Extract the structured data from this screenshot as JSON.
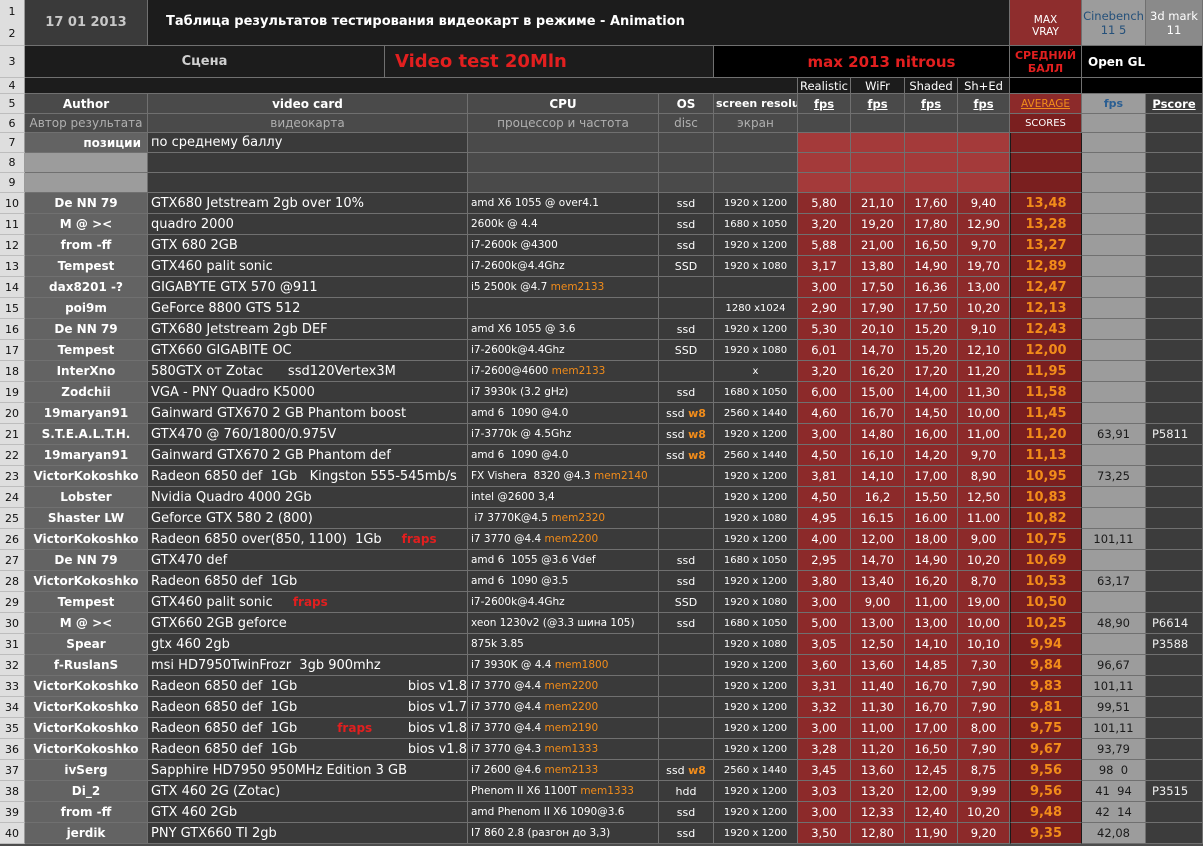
{
  "header": {
    "date": "17 01  2013",
    "title": "Таблица результатов тестирования видеокарт в режиме - Animation",
    "max_vray": "MAX VRAY",
    "cinebench": "Cinebench",
    "cinebench_ver": "11 5",
    "mark3d": "3d mark",
    "mark3d_ver": "11",
    "scene_label": "Сцена",
    "video_test": "Video test 20Mln",
    "max_version": "max 2013 nitrous",
    "avg_ball": "СРЕДНИЙ БАЛЛ",
    "opengl": "Open GL",
    "sub_realistic": "Realistic",
    "sub_wifr": "WiFr",
    "sub_shaded": "Shaded",
    "sub_shed": "Sh+Ed",
    "col_author": "Author",
    "col_videocard": "video card",
    "col_cpu": "CPU",
    "col_os": "OS",
    "col_res": "screen resolut",
    "fps": "fps",
    "average": "AVERAGE",
    "pscore": "Pscore",
    "ru_author": "Автор результата",
    "ru_videocard": "видеокарта",
    "ru_cpu": "процессор и частота",
    "ru_disc": "disc",
    "ru_screen": "экран",
    "scores": "SCORES",
    "positions": "позиции",
    "by_avg": "по среднему баллу"
  },
  "colors": {
    "sheet_bg": "#4d4d4d",
    "author_bg": "#636363",
    "data_bg": "#3a3a3a",
    "fps_bg": "#8c2a2a",
    "avg_bg": "#7a1f1f",
    "avg_text": "#f28c1a",
    "cinebench_bg": "#9c9c9c",
    "title_red": "#e21f1f"
  },
  "rows": [
    {
      "n": "10",
      "author": "De NN 79",
      "card": "GTX680 Jetstream 2gb over 10%",
      "cpu": "amd X6 1055 @ over4.1",
      "cpu_hl": "",
      "os": "ssd",
      "os_hl": "",
      "res": "1920 x 1200",
      "f": [
        "5,80",
        "21,10",
        "17,60",
        "9,40"
      ],
      "avg": "13,48",
      "cb": "",
      "mark": ""
    },
    {
      "n": "11",
      "author": "M @ ><",
      "card": "quadro 2000",
      "cpu": "2600k @ 4.4",
      "cpu_hl": "",
      "os": "ssd",
      "os_hl": "",
      "res": "1680 x 1050",
      "f": [
        "3,20",
        "19,20",
        "17,80",
        "12,90"
      ],
      "avg": "13,28",
      "cb": "",
      "mark": ""
    },
    {
      "n": "12",
      "author": "from -ff",
      "card": "GTX 680 2GB",
      "cpu": "i7-2600k @4300",
      "cpu_hl": "",
      "os": "ssd",
      "os_hl": "",
      "res": "1920 x 1200",
      "f": [
        "5,88",
        "21,00",
        "16,50",
        "9,70"
      ],
      "avg": "13,27",
      "cb": "",
      "mark": ""
    },
    {
      "n": "13",
      "author": "Tempest",
      "card": "GTX460 palit sonic",
      "cpu": "i7-2600k@4.4Ghz",
      "cpu_hl": "",
      "os": "SSD",
      "os_hl": "",
      "res": "1920 x 1080",
      "f": [
        "3,17",
        "13,80",
        "14,90",
        "19,70"
      ],
      "avg": "12,89",
      "cb": "",
      "mark": ""
    },
    {
      "n": "14",
      "author": "dax8201 -?",
      "card": "GIGABYTE GTX 570 @911",
      "cpu": "i5 2500k @4.7 ",
      "cpu_hl": "mem2133",
      "os": "",
      "os_hl": "",
      "res": "",
      "f": [
        "3,00",
        "17,50",
        "16,36",
        "13,00"
      ],
      "avg": "12,47",
      "cb": "",
      "mark": ""
    },
    {
      "n": "15",
      "author": "poi9m",
      "card": "GeForce 8800 GTS 512",
      "cpu": "",
      "cpu_hl": "",
      "os": "",
      "os_hl": "",
      "res": "1280 x1024",
      "f": [
        "2,90",
        "17,90",
        "17,50",
        "10,20"
      ],
      "avg": "12,13",
      "cb": "",
      "mark": ""
    },
    {
      "n": "16",
      "author": "De NN 79",
      "card": "GTX680 Jetstream 2gb DEF",
      "cpu": "amd X6 1055 @ 3.6",
      "cpu_hl": "",
      "os": "ssd",
      "os_hl": "",
      "res": "1920 x 1200",
      "f": [
        "5,30",
        "20,10",
        "15,20",
        "9,10"
      ],
      "avg": "12,43",
      "cb": "",
      "mark": ""
    },
    {
      "n": "17",
      "author": "Tempest",
      "card": "GTX660 GIGABITE OC",
      "cpu": "i7-2600k@4.4Ghz",
      "cpu_hl": "",
      "os": "SSD",
      "os_hl": "",
      "res": "1920 x 1080",
      "f": [
        "6,01",
        "14,70",
        "15,20",
        "12,10"
      ],
      "avg": "12,00",
      "cb": "",
      "mark": ""
    },
    {
      "n": "18",
      "author": "InterXno",
      "card": "580GTX от Zotac      ssd120Vertex3M",
      "cpu": "i7-2600@4600 ",
      "cpu_hl": "mem2133",
      "os": "",
      "os_hl": "",
      "res": "x",
      "f": [
        "3,20",
        "16,20",
        "17,20",
        "11,20"
      ],
      "avg": "11,95",
      "cb": "",
      "mark": ""
    },
    {
      "n": "19",
      "author": "Zodchii",
      "card": "VGA - PNY Quadro K5000",
      "cpu": "i7 3930k (3.2 gHz)",
      "cpu_hl": "",
      "os": "ssd",
      "os_hl": "",
      "res": "1680 x 1050",
      "f": [
        "6,00",
        "15,00",
        "14,00",
        "11,30"
      ],
      "avg": "11,58",
      "cb": "",
      "mark": ""
    },
    {
      "n": "20",
      "author": "19maryan91",
      "card": "Gainward GTX670 2 GB Phantom boost",
      "cpu": "amd 6  1090 @4.0",
      "cpu_hl": "",
      "os": "ssd ",
      "os_hl": "w8",
      "res": "2560 x 1440",
      "f": [
        "4,60",
        "16,70",
        "14,50",
        "10,00"
      ],
      "avg": "11,45",
      "cb": "",
      "mark": ""
    },
    {
      "n": "21",
      "author": "S.T.E.A.L.T.H.",
      "card": "GTX470 @ 760/1800/0.975V",
      "cpu": "i7-3770k @ 4.5Ghz",
      "cpu_hl": "",
      "os": "ssd ",
      "os_hl": "w8",
      "res": "1920 x 1200",
      "f": [
        "3,00",
        "14,80",
        "16,00",
        "11,00"
      ],
      "avg": "11,20",
      "cb": "63,91",
      "mark": "P5811"
    },
    {
      "n": "22",
      "author": "19maryan91",
      "card": "Gainward GTX670 2 GB Phantom def",
      "cpu": "amd 6  1090 @4.0",
      "cpu_hl": "",
      "os": "ssd ",
      "os_hl": "w8",
      "res": "2560 x 1440",
      "f": [
        "4,50",
        "16,10",
        "14,20",
        "9,70"
      ],
      "avg": "11,13",
      "cb": "",
      "mark": ""
    },
    {
      "n": "23",
      "author": "VictorKokoshko",
      "card": "Radeon 6850 def  1Gb   Kingston 555-545mb/s",
      "cpu": "FX Vishera  8320 @4.3 ",
      "cpu_hl": "mem2140",
      "os": "",
      "os_hl": "",
      "res": "1920 x 1200",
      "f": [
        "3,81",
        "14,10",
        "17,00",
        "8,90"
      ],
      "avg": "10,95",
      "cb": "73,25",
      "mark": ""
    },
    {
      "n": "24",
      "author": "Lobster",
      "card": "Nvidia Quadro 4000 2Gb",
      "cpu": "intel @2600 3,4",
      "cpu_hl": "",
      "os": "",
      "os_hl": "",
      "res": "1920 x 1200",
      "f": [
        "4,50",
        "16,2",
        "15,50",
        "12,50"
      ],
      "avg": "10,83",
      "cb": "",
      "mark": ""
    },
    {
      "n": "25",
      "author": "Shaster LW",
      "card": "Geforce GTX 580 2 (800)",
      "cpu": " i7 3770K@4.5 ",
      "cpu_hl": "mem2320",
      "os": "",
      "os_hl": "",
      "res": "1920 x 1080",
      "f": [
        "4,95",
        "16.15",
        "16.00",
        "11.00"
      ],
      "avg": "10,82",
      "cb": "",
      "mark": ""
    },
    {
      "n": "26",
      "author": "VictorKokoshko",
      "card": "Radeon 6850 over(850, 1100)  1Gb",
      "card_red": "fraps",
      "cpu": "i7 3770 @4.4 ",
      "cpu_hl": "mem2200",
      "os": "",
      "os_hl": "",
      "res": "1920 x 1200",
      "f": [
        "4,00",
        "12,00",
        "18,00",
        "9,00"
      ],
      "avg": "10,75",
      "cb": "101,11",
      "mark": ""
    },
    {
      "n": "27",
      "author": "De NN 79",
      "card": "GTX470 def",
      "cpu": "amd 6  1055 @3.6 Vdef",
      "cpu_hl": "",
      "os": "ssd",
      "os_hl": "",
      "res": "1680 x 1050",
      "f": [
        "2,95",
        "14,70",
        "14,90",
        "10,20"
      ],
      "avg": "10,69",
      "cb": "",
      "mark": ""
    },
    {
      "n": "28",
      "author": "VictorKokoshko",
      "card": "Radeon 6850 def  1Gb",
      "cpu": "amd 6  1090 @3.5",
      "cpu_hl": "",
      "os": "ssd",
      "os_hl": "",
      "res": "1920 x 1200",
      "f": [
        "3,80",
        "13,40",
        "16,20",
        "8,70"
      ],
      "avg": "10,53",
      "cb": "63,17",
      "mark": ""
    },
    {
      "n": "29",
      "author": "Tempest",
      "card": "GTX460 palit sonic",
      "card_red": "fraps",
      "cpu": "i7-2600k@4.4Ghz",
      "cpu_hl": "",
      "os": "SSD",
      "os_hl": "",
      "res": "1920 x 1080",
      "f": [
        "3,00",
        "9,00",
        "11,00",
        "19,00"
      ],
      "avg": "10,50",
      "cb": "",
      "mark": ""
    },
    {
      "n": "30",
      "author": "M @ ><",
      "card": "GTX660 2GB geforce",
      "cpu": "xeon 1230v2 (@3.3 шина 105)",
      "cpu_hl": "",
      "os": "ssd",
      "os_hl": "",
      "res": "1680 x 1050",
      "f": [
        "5,00",
        "13,00",
        "13,00",
        "10,00"
      ],
      "avg": "10,25",
      "cb": "48,90",
      "mark": "P6614"
    },
    {
      "n": "31",
      "author": "Spear",
      "card": "gtx 460 2gb",
      "cpu": "875k 3.85",
      "cpu_hl": "",
      "os": "",
      "os_hl": "",
      "res": "1920 x 1080",
      "f": [
        "3,05",
        "12,50",
        "14,10",
        "10,10"
      ],
      "avg": "9,94",
      "cb": "",
      "mark": "P3588"
    },
    {
      "n": "32",
      "author": "f-RuslanS",
      "card": "msi HD7950TwinFrozr  3gb 900mhz",
      "cpu": "i7 3930K @ 4.4 ",
      "cpu_hl": "mem1800",
      "os": "",
      "os_hl": "",
      "res": "1920 x 1200",
      "f": [
        "3,60",
        "13,60",
        "14,85",
        "7,30"
      ],
      "avg": "9,84",
      "cb": "96,67",
      "mark": ""
    },
    {
      "n": "33",
      "author": "VictorKokoshko",
      "card": "Radeon 6850 def  1Gb",
      "card_bios": "bios v1.8",
      "cpu": "i7 3770 @4.4 ",
      "cpu_hl": "mem2200",
      "os": "",
      "os_hl": "",
      "res": "1920 x 1200",
      "f": [
        "3,31",
        "11,40",
        "16,70",
        "7,90"
      ],
      "avg": "9,83",
      "cb": "101,11",
      "mark": ""
    },
    {
      "n": "34",
      "author": "VictorKokoshko",
      "card": "Radeon 6850 def  1Gb",
      "card_bios": "bios v1.7",
      "cpu": "i7 3770 @4.4 ",
      "cpu_hl": "mem2200",
      "os": "",
      "os_hl": "",
      "res": "1920 x 1200",
      "f": [
        "3,32",
        "11,30",
        "16,70",
        "7,90"
      ],
      "avg": "9,81",
      "cb": "99,51",
      "mark": ""
    },
    {
      "n": "35",
      "author": "VictorKokoshko",
      "card": "Radeon 6850 def  1Gb",
      "card_red": "fraps",
      "card_bios": "bios v1.8",
      "cpu": "i7 3770 @4.4 ",
      "cpu_hl": "mem2190",
      "os": "",
      "os_hl": "",
      "res": "1920 x 1200",
      "f": [
        "3,00",
        "11,00",
        "17,00",
        "8,00"
      ],
      "avg": "9,75",
      "cb": "101,11",
      "mark": ""
    },
    {
      "n": "36",
      "author": "VictorKokoshko",
      "card": "Radeon 6850 def  1Gb",
      "card_bios": "bios v1.8",
      "cpu": "i7 3770 @4.3 ",
      "cpu_hl": "mem1333",
      "os": "",
      "os_hl": "",
      "res": "1920 x 1200",
      "f": [
        "3,28",
        "11,20",
        "16,50",
        "7,90"
      ],
      "avg": "9,67",
      "cb": "93,79",
      "mark": ""
    },
    {
      "n": "37",
      "author": "ivSerg",
      "card": "Sapphire HD7950 950MHz Edition 3 GB",
      "cpu": "i7 2600 @4.6 ",
      "cpu_hl": "mem2133",
      "os": "ssd ",
      "os_hl": "w8",
      "res": "2560 x 1440",
      "f": [
        "3,45",
        "13,60",
        "12,45",
        "8,75"
      ],
      "avg": "9,56",
      "cb": "98  0",
      "mark": ""
    },
    {
      "n": "38",
      "author": "Di_2",
      "card": "GTX 460 2G (Zotac)",
      "cpu": "Phenom II X6 1100T ",
      "cpu_hl": "mem1333",
      "os": "hdd",
      "os_hl": "",
      "res": "1920 x 1200",
      "f": [
        "3,03",
        "13,20",
        "12,00",
        "9,99"
      ],
      "avg": "9,56",
      "cb": "41  94",
      "mark": "P3515"
    },
    {
      "n": "39",
      "author": "from -ff",
      "card": "GTX 460 2Gb",
      "cpu": "amd Phenom II X6 1090@3.6",
      "cpu_hl": "",
      "os": "ssd",
      "os_hl": "",
      "res": "1920 x 1200",
      "f": [
        "3,00",
        "12,33",
        "12,40",
        "10,20"
      ],
      "avg": "9,48",
      "cb": "42  14",
      "mark": ""
    },
    {
      "n": "40",
      "author": "jerdik",
      "card": "PNY GTX660 TI 2gb",
      "cpu": "I7 860 2.8 (разгон до 3,3)",
      "cpu_hl": "",
      "os": "ssd",
      "os_hl": "",
      "res": "1920 x 1200",
      "f": [
        "3,50",
        "12,80",
        "11,90",
        "9,20"
      ],
      "avg": "9,35",
      "cb": "42,08",
      "mark": ""
    }
  ]
}
